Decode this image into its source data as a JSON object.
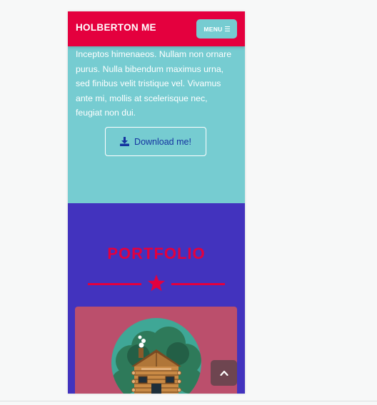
{
  "navbar": {
    "brand": "HOLBERTON ME",
    "menu_label": "MENU"
  },
  "about": {
    "text": "Inceptos himenaeos. Nullam non ornare\npurus. Nulla bibendum maximus urna,\nsed finibus velit tristique vel. Vivamus\nante mi, mollis at scelerisque nec,\nfeugiat non dui.",
    "download_label": "Download me!"
  },
  "portfolio": {
    "title": "PORTFOLIO",
    "items": [
      {
        "image": "log-cabin-illustration"
      }
    ]
  },
  "icons": {
    "menu": "bars-icon",
    "download": "download-icon",
    "divider": "star-icon",
    "scroll_top": "chevron-up-icon"
  },
  "colors": {
    "primary": "#e4003e",
    "secondary": "#76ccd1",
    "portfolio_bg": "#4233be",
    "card_bg": "#bb4f6c",
    "download_text": "#1433a0"
  }
}
